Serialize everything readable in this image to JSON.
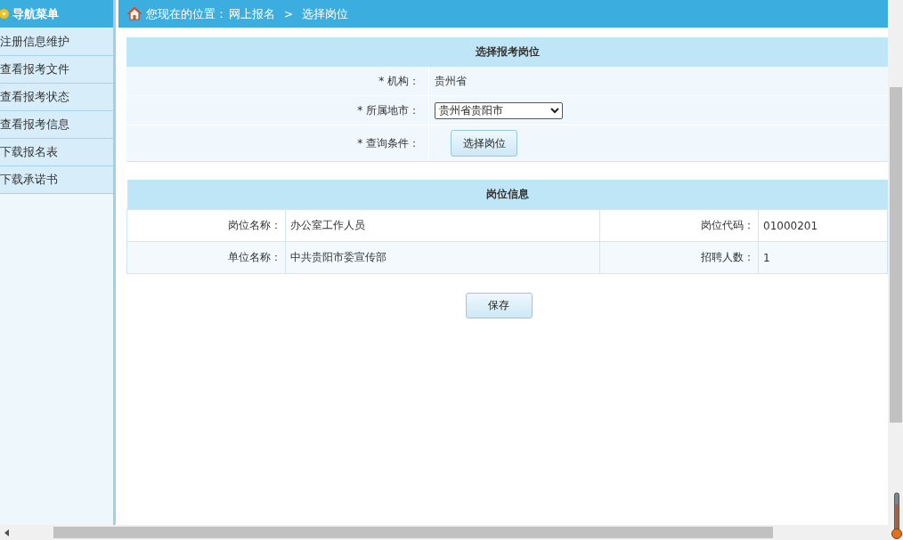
{
  "sidebar": {
    "title": "导航菜单",
    "items": [
      {
        "label": "注册信息维护"
      },
      {
        "label": "查看报考文件"
      },
      {
        "label": "查看报考状态"
      },
      {
        "label": "查看报考信息"
      },
      {
        "label": "下载报名表"
      },
      {
        "label": "下载承诺书"
      }
    ]
  },
  "breadcrumb": {
    "prefix": "您现在的位置：",
    "path": [
      "网上报名",
      "选择岗位"
    ],
    "separator": ">"
  },
  "selection_form": {
    "title": "选择报考岗位",
    "fields": [
      {
        "kind": "text",
        "label": "* 机构：",
        "value": "贵州省"
      },
      {
        "kind": "select",
        "label": "* 所属地市：",
        "value": "贵州省贵阳市"
      },
      {
        "kind": "button",
        "label": "* 查询条件：",
        "value": "选择岗位"
      }
    ]
  },
  "position_info": {
    "title": "岗位信息",
    "rows": [
      [
        {
          "label": "岗位名称：",
          "value": "办公室工作人员"
        },
        {
          "label": "岗位代码：",
          "value": "01000201"
        }
      ],
      [
        {
          "label": "单位名称：",
          "value": "中共贵阳市委宣传部"
        },
        {
          "label": "招聘人数：",
          "value": "1"
        }
      ]
    ]
  },
  "save_button": "保存"
}
